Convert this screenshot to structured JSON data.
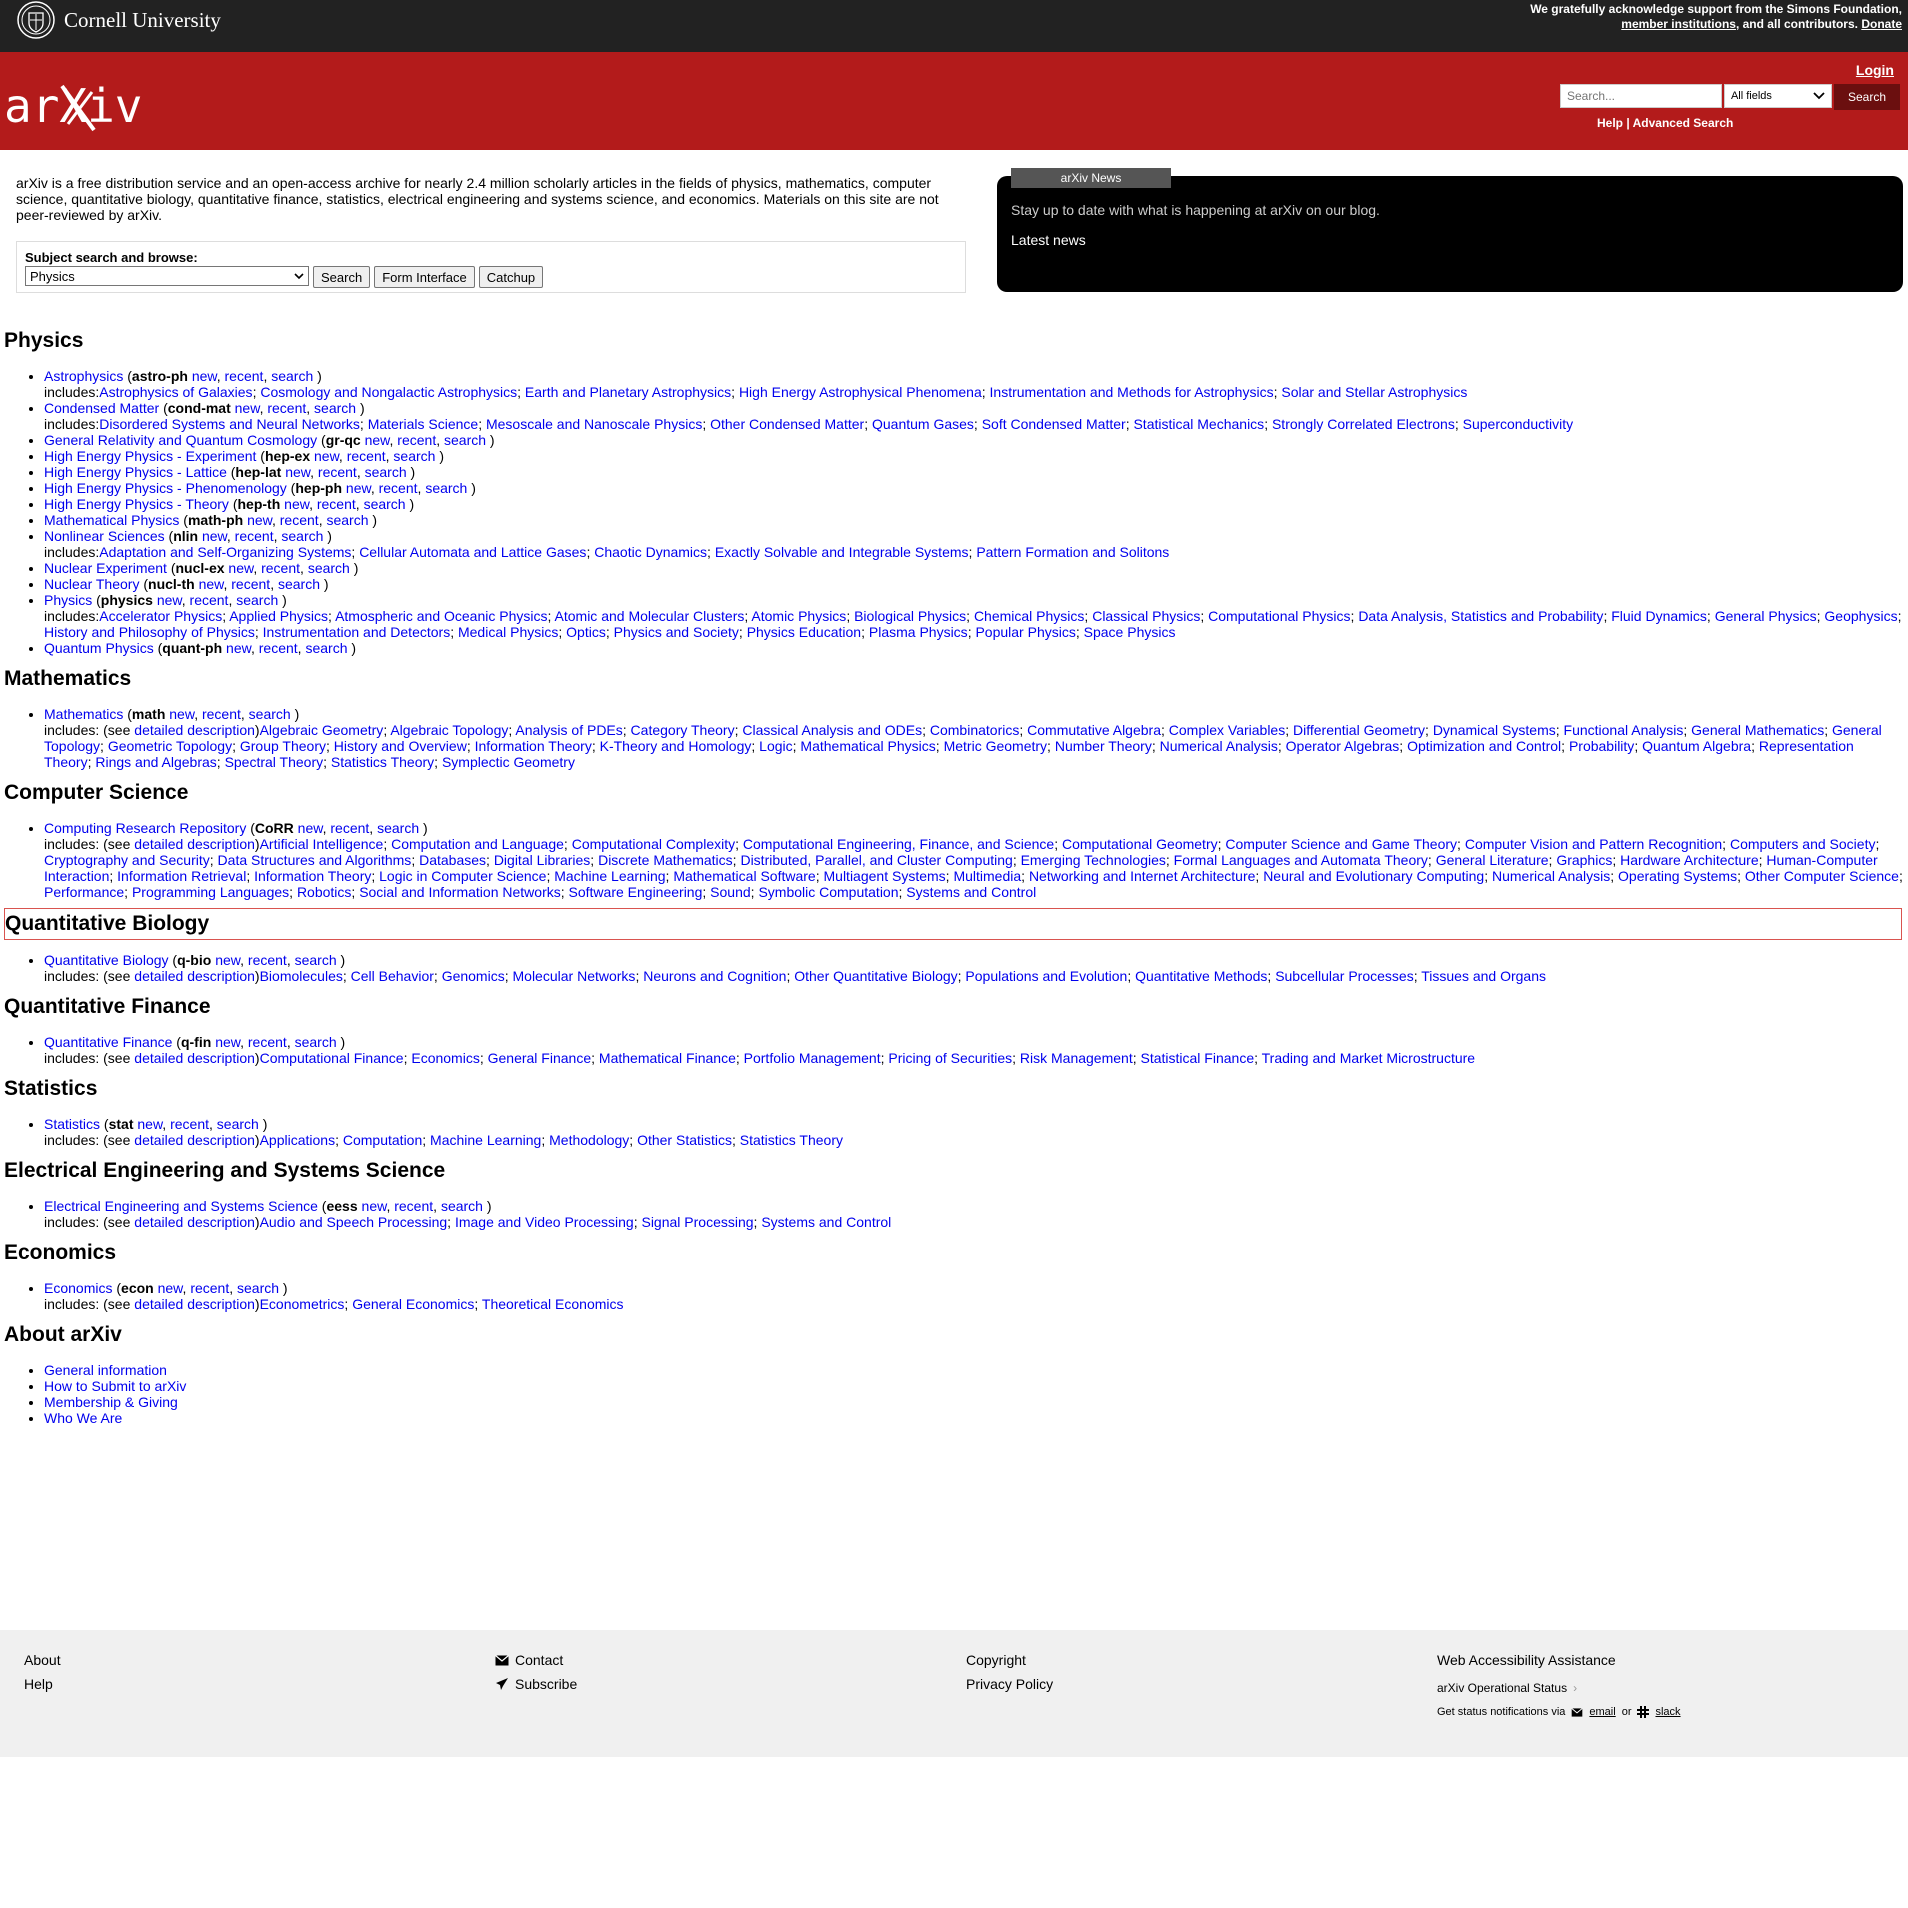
{
  "topbar": {
    "university": "Cornell University",
    "support_prefix": "We gratefully acknowledge support from the Simons Foundation,",
    "support_link": "member institutions",
    "support_mid": ", and all contributors.",
    "donate": "Donate"
  },
  "header": {
    "logo_text": "arXiv",
    "login": "Login",
    "search_placeholder": "Search...",
    "search_field": "All fields",
    "search_button": "Search",
    "help": "Help",
    "sep": "|",
    "advanced": "Advanced Search"
  },
  "intro": "arXiv is a free distribution service and an open-access archive for nearly 2.4 million scholarly articles in the fields of physics, mathematics, computer science, quantitative biology, quantitative finance, statistics, electrical engineering and systems science, and economics. Materials on this site are not peer-reviewed by arXiv.",
  "subject": {
    "label": "Subject search and browse:",
    "selected": "Physics",
    "buttons": [
      "Search",
      "Form Interface",
      "Catchup"
    ]
  },
  "news": {
    "tab": "arXiv News",
    "blog": "Stay up to date with what is happening at arXiv on our blog.",
    "latest": "Latest news"
  },
  "sections": [
    {
      "title": "Physics",
      "items": [
        {
          "name": "Astrophysics",
          "code": "astro-ph",
          "prefix": "includes:",
          "subs": [
            "Astrophysics of Galaxies",
            "Cosmology and Nongalactic Astrophysics",
            "Earth and Planetary Astrophysics",
            "High Energy Astrophysical Phenomena",
            "Instrumentation and Methods for Astrophysics",
            "Solar and Stellar Astrophysics"
          ]
        },
        {
          "name": "Condensed Matter",
          "code": "cond-mat",
          "prefix": "includes:",
          "subs": [
            "Disordered Systems and Neural Networks",
            "Materials Science",
            "Mesoscale and Nanoscale Physics",
            "Other Condensed Matter",
            "Quantum Gases",
            "Soft Condensed Matter",
            "Statistical Mechanics",
            "Strongly Correlated Electrons",
            "Superconductivity"
          ]
        },
        {
          "name": "General Relativity and Quantum Cosmology",
          "code": "gr-qc",
          "subs": []
        },
        {
          "name": "High Energy Physics - Experiment",
          "code": "hep-ex",
          "subs": []
        },
        {
          "name": "High Energy Physics - Lattice",
          "code": "hep-lat",
          "subs": []
        },
        {
          "name": "High Energy Physics - Phenomenology",
          "code": "hep-ph",
          "subs": []
        },
        {
          "name": "High Energy Physics - Theory",
          "code": "hep-th",
          "subs": []
        },
        {
          "name": "Mathematical Physics",
          "code": "math-ph",
          "subs": []
        },
        {
          "name": "Nonlinear Sciences",
          "code": "nlin",
          "prefix": "includes:",
          "subs": [
            "Adaptation and Self-Organizing Systems",
            "Cellular Automata and Lattice Gases",
            "Chaotic Dynamics",
            "Exactly Solvable and Integrable Systems",
            "Pattern Formation and Solitons"
          ]
        },
        {
          "name": "Nuclear Experiment",
          "code": "nucl-ex",
          "subs": []
        },
        {
          "name": "Nuclear Theory",
          "code": "nucl-th",
          "subs": []
        },
        {
          "name": "Physics",
          "code": "physics",
          "prefix": "includes:",
          "subs": [
            "Accelerator Physics",
            "Applied Physics",
            "Atmospheric and Oceanic Physics",
            "Atomic and Molecular Clusters",
            "Atomic Physics",
            "Biological Physics",
            "Chemical Physics",
            "Classical Physics",
            "Computational Physics",
            "Data Analysis, Statistics and Probability",
            "Fluid Dynamics",
            "General Physics",
            "Geophysics",
            "History and Philosophy of Physics",
            "Instrumentation and Detectors",
            "Medical Physics",
            "Optics",
            "Physics and Society",
            "Physics Education",
            "Plasma Physics",
            "Popular Physics",
            "Space Physics"
          ]
        },
        {
          "name": "Quantum Physics",
          "code": "quant-ph",
          "subs": []
        }
      ]
    },
    {
      "title": "Mathematics",
      "items": [
        {
          "name": "Mathematics",
          "code": "math",
          "prefix": "includes: (see ",
          "detail": true,
          "subs": [
            "Algebraic Geometry",
            "Algebraic Topology",
            "Analysis of PDEs",
            "Category Theory",
            "Classical Analysis and ODEs",
            "Combinatorics",
            "Commutative Algebra",
            "Complex Variables",
            "Differential Geometry",
            "Dynamical Systems",
            "Functional Analysis",
            "General Mathematics",
            "General Topology",
            "Geometric Topology",
            "Group Theory",
            "History and Overview",
            "Information Theory",
            "K-Theory and Homology",
            "Logic",
            "Mathematical Physics",
            "Metric Geometry",
            "Number Theory",
            "Numerical Analysis",
            "Operator Algebras",
            "Optimization and Control",
            "Probability",
            "Quantum Algebra",
            "Representation Theory",
            "Rings and Algebras",
            "Spectral Theory",
            "Statistics Theory",
            "Symplectic Geometry"
          ]
        }
      ]
    },
    {
      "title": "Computer Science",
      "items": [
        {
          "name": "Computing Research Repository",
          "code": "CoRR",
          "prefix": "includes: (see ",
          "detail": true,
          "subs": [
            "Artificial Intelligence",
            "Computation and Language",
            "Computational Complexity",
            "Computational Engineering, Finance, and Science",
            "Computational Geometry",
            "Computer Science and Game Theory",
            "Computer Vision and Pattern Recognition",
            "Computers and Society",
            "Cryptography and Security",
            "Data Structures and Algorithms",
            "Databases",
            "Digital Libraries",
            "Discrete Mathematics",
            "Distributed, Parallel, and Cluster Computing",
            "Emerging Technologies",
            "Formal Languages and Automata Theory",
            "General Literature",
            "Graphics",
            "Hardware Architecture",
            "Human-Computer Interaction",
            "Information Retrieval",
            "Information Theory",
            "Logic in Computer Science",
            "Machine Learning",
            "Mathematical Software",
            "Multiagent Systems",
            "Multimedia",
            "Networking and Internet Architecture",
            "Neural and Evolutionary Computing",
            "Numerical Analysis",
            "Operating Systems",
            "Other Computer Science",
            "Performance",
            "Programming Languages",
            "Robotics",
            "Social and Information Networks",
            "Software Engineering",
            "Sound",
            "Symbolic Computation",
            "Systems and Control"
          ]
        }
      ]
    },
    {
      "title": "Quantitative Biology",
      "boxed": true,
      "items": [
        {
          "name": "Quantitative Biology",
          "code": "q-bio",
          "prefix": "includes: (see ",
          "detail": true,
          "subs": [
            "Biomolecules",
            "Cell Behavior",
            "Genomics",
            "Molecular Networks",
            "Neurons and Cognition",
            "Other Quantitative Biology",
            "Populations and Evolution",
            "Quantitative Methods",
            "Subcellular Processes",
            "Tissues and Organs"
          ]
        }
      ]
    },
    {
      "title": "Quantitative Finance",
      "items": [
        {
          "name": "Quantitative Finance",
          "code": "q-fin",
          "prefix": "includes: (see ",
          "detail": true,
          "subs": [
            "Computational Finance",
            "Economics",
            "General Finance",
            "Mathematical Finance",
            "Portfolio Management",
            "Pricing of Securities",
            "Risk Management",
            "Statistical Finance",
            "Trading and Market Microstructure"
          ]
        }
      ]
    },
    {
      "title": "Statistics",
      "items": [
        {
          "name": "Statistics",
          "code": "stat",
          "prefix": "includes: (see ",
          "detail": true,
          "subs": [
            "Applications",
            "Computation",
            "Machine Learning",
            "Methodology",
            "Other Statistics",
            "Statistics Theory"
          ]
        }
      ]
    },
    {
      "title": "Electrical Engineering and Systems Science",
      "items": [
        {
          "name": "Electrical Engineering and Systems Science",
          "code": "eess",
          "prefix": "includes: (see ",
          "detail": true,
          "subs": [
            "Audio and Speech Processing",
            "Image and Video Processing",
            "Signal Processing",
            "Systems and Control"
          ]
        }
      ]
    },
    {
      "title": "Economics",
      "items": [
        {
          "name": "Economics",
          "code": "econ",
          "prefix": "includes: (see ",
          "detail": true,
          "subs": [
            "Econometrics",
            "General Economics",
            "Theoretical Economics"
          ]
        }
      ]
    }
  ],
  "listing_links": [
    "new",
    "recent",
    "search"
  ],
  "detail_link": "detailed description",
  "about": {
    "title": "About arXiv",
    "links": [
      "General information",
      "How to Submit to arXiv",
      "Membership & Giving",
      "Who We Are"
    ]
  },
  "footer": {
    "col1": [
      "About",
      "Help"
    ],
    "col2": [
      "Contact",
      "Subscribe"
    ],
    "col3": [
      "Copyright",
      "Privacy Policy"
    ],
    "accessibility": "Web Accessibility Assistance",
    "status": "arXiv Operational Status",
    "notify_prefix": "Get status notifications via",
    "email": "email",
    "or": "or",
    "slack": "slack"
  }
}
